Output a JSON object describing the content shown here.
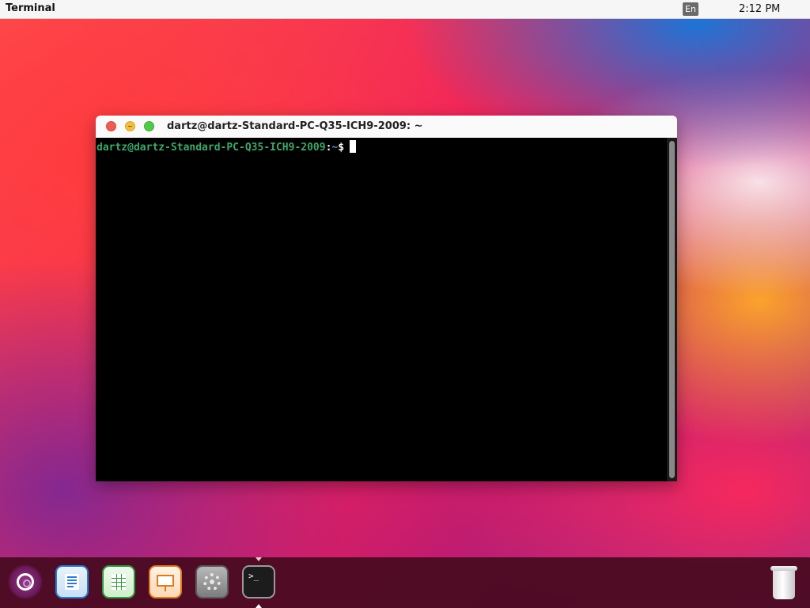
{
  "topbar": {
    "app_name": "Terminal",
    "lang_indicator": "En",
    "clock": "2:12 PM"
  },
  "terminal": {
    "title": "dartz@dartz-Standard-PC-Q35-ICH9-2009: ~",
    "prompt_user_host": "dartz@dartz-Standard-PC-Q35-ICH9-2009",
    "prompt_sep": ":",
    "prompt_path": "~",
    "prompt_symbol": "$",
    "colors": {
      "user_host": "#3ea86b",
      "path": "#5f8fcf",
      "background": "#000000"
    }
  },
  "dock": {
    "items": [
      {
        "name": "launcher",
        "icon": "ubuntu-launcher-icon"
      },
      {
        "name": "LibreOffice Writer",
        "icon": "writer-icon"
      },
      {
        "name": "LibreOffice Calc",
        "icon": "calc-icon"
      },
      {
        "name": "LibreOffice Impress",
        "icon": "impress-icon"
      },
      {
        "name": "Settings",
        "icon": "settings-gear-icon"
      },
      {
        "name": "Terminal",
        "icon": "terminal-icon",
        "running": true
      },
      {
        "name": "Trash",
        "icon": "trash-icon"
      }
    ],
    "terminal_glyph": ">_"
  }
}
